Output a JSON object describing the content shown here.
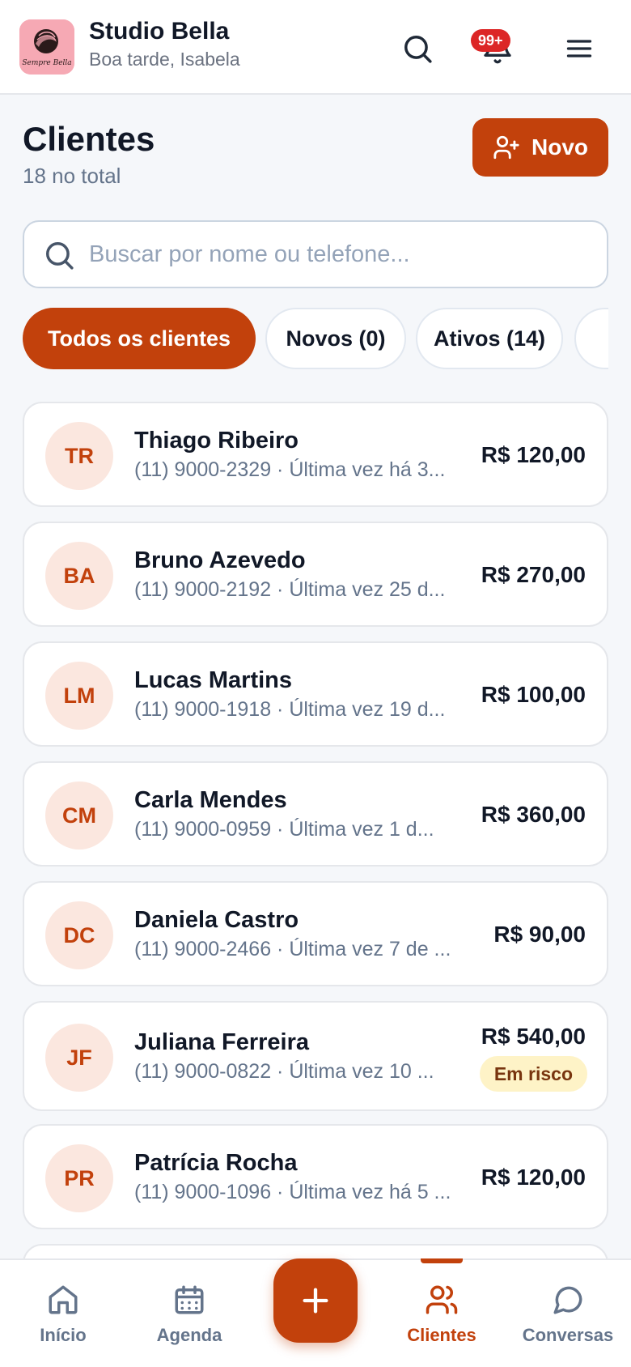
{
  "colors": {
    "accent": "#c2410c",
    "avatar_bg": "#fbe7df",
    "badge": "#dc2626",
    "risk_bg": "#fef3c7",
    "risk_text": "#78350f"
  },
  "header": {
    "logo_text": "Sempre Bella",
    "brand_name": "Studio Bella",
    "greeting": "Boa tarde, Isabela",
    "notification_badge": "99+",
    "icons": [
      "search-icon",
      "bell-icon",
      "menu-icon"
    ]
  },
  "page": {
    "title": "Clientes",
    "subtitle": "18 no total",
    "new_button_label": "Novo",
    "new_button_icon": "user-plus-icon"
  },
  "search": {
    "placeholder": "Buscar por nome ou telefone...",
    "value": ""
  },
  "filters": [
    {
      "label": "Todos os clientes",
      "active": true
    },
    {
      "label": "Novos (0)",
      "active": false
    },
    {
      "label": "Ativos (14)",
      "active": false
    }
  ],
  "clients": [
    {
      "initials": "TR",
      "name": "Thiago Ribeiro",
      "info": "(11) 9000-2329 · Última vez há 3...",
      "amount": "R$ 120,00"
    },
    {
      "initials": "BA",
      "name": "Bruno Azevedo",
      "info": "(11) 9000-2192 · Última vez 25 d...",
      "amount": "R$ 270,00"
    },
    {
      "initials": "LM",
      "name": "Lucas Martins",
      "info": "(11) 9000-1918 · Última vez 19 d...",
      "amount": "R$ 100,00"
    },
    {
      "initials": "CM",
      "name": "Carla Mendes",
      "info": "(11) 9000-0959 · Última vez 1 d...",
      "amount": "R$ 360,00"
    },
    {
      "initials": "DC",
      "name": "Daniela Castro",
      "info": "(11) 9000-2466 · Última vez 7 de ...",
      "amount": "R$ 90,00"
    },
    {
      "initials": "JF",
      "name": "Juliana Ferreira",
      "info": "(11) 9000-0822 · Última vez 10 ...",
      "amount": "R$ 540,00",
      "badge": "Em risco"
    },
    {
      "initials": "PR",
      "name": "Patrícia Rocha",
      "info": "(11) 9000-1096 · Última vez há 5 ...",
      "amount": "R$ 120,00"
    }
  ],
  "bottom_nav": [
    {
      "label": "Início",
      "icon": "home-icon",
      "active": false
    },
    {
      "label": "Agenda",
      "icon": "calendar-icon",
      "active": false
    },
    {
      "label": "Clientes",
      "icon": "users-icon",
      "active": true
    },
    {
      "label": "Conversas",
      "icon": "chat-icon",
      "active": false
    }
  ],
  "fab_icon": "plus-icon"
}
